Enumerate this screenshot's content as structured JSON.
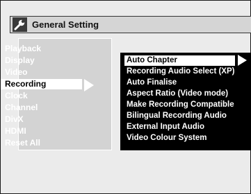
{
  "header": {
    "title": "General Setting",
    "icon": "wrench-icon"
  },
  "left_menu": {
    "items": [
      {
        "label": "Playback",
        "selected": false
      },
      {
        "label": "Display",
        "selected": false
      },
      {
        "label": "Video",
        "selected": false
      },
      {
        "label": "Recording",
        "selected": true
      },
      {
        "label": "Clock",
        "selected": false
      },
      {
        "label": "Channel",
        "selected": false
      },
      {
        "label": "DivX",
        "selected": false
      },
      {
        "label": "HDMI",
        "selected": false
      },
      {
        "label": "Reset All",
        "selected": false
      }
    ]
  },
  "right_menu": {
    "items": [
      {
        "label": "Auto Chapter",
        "selected": true
      },
      {
        "label": "Recording Audio Select (XP)",
        "selected": false
      },
      {
        "label": "Auto Finalise",
        "selected": false
      },
      {
        "label": "Aspect Ratio (Video mode)",
        "selected": false
      },
      {
        "label": "Make Recording Compatible",
        "selected": false
      },
      {
        "label": "Bilingual Recording Audio",
        "selected": false
      },
      {
        "label": "External Input Audio",
        "selected": false
      },
      {
        "label": "Video Colour System",
        "selected": false
      }
    ]
  },
  "colors": {
    "screen_bg": "#ebebeb",
    "left_panel_bg": "#d3d3d3",
    "right_panel_bg": "#000000",
    "highlight_bg": "#ffffff",
    "inactive_text": "#ffffff",
    "selected_text": "#000000"
  }
}
